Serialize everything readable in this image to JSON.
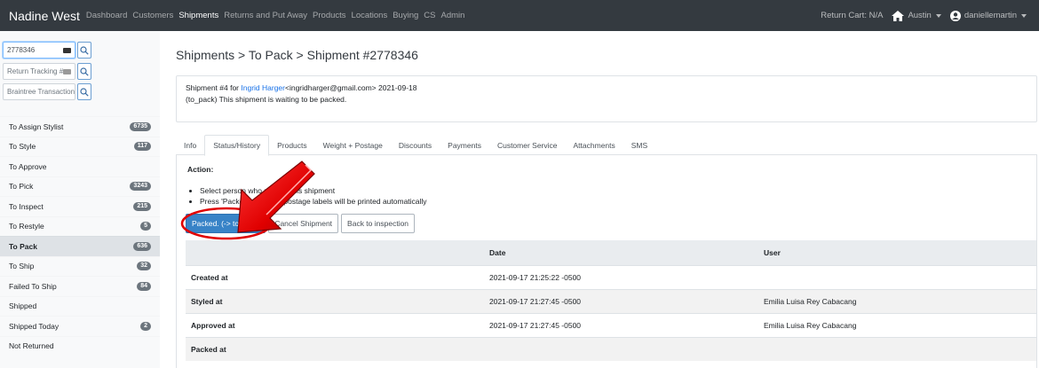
{
  "navbar": {
    "brand": "Nadine West",
    "links": [
      "Dashboard",
      "Customers",
      "Shipments",
      "Returns and Put Away",
      "Products",
      "Locations",
      "Buying",
      "CS",
      "Admin"
    ],
    "active_link": "Shipments",
    "return_cart": "Return Cart: N/A",
    "location": "Austin",
    "user": "daniellemartin"
  },
  "sidebar": {
    "search_value": "2778346",
    "return_tracking_placeholder": "Return Tracking #",
    "braintree_placeholder": "Braintree Transaction",
    "items": [
      {
        "label": "To Assign Stylist",
        "badge": "6735"
      },
      {
        "label": "To Style",
        "badge": "117"
      },
      {
        "label": "To Approve",
        "badge": ""
      },
      {
        "label": "To Pick",
        "badge": "3243"
      },
      {
        "label": "To Inspect",
        "badge": "215"
      },
      {
        "label": "To Restyle",
        "badge": "5"
      },
      {
        "label": "To Pack",
        "badge": "636"
      },
      {
        "label": "To Ship",
        "badge": "32"
      },
      {
        "label": "Failed To Ship",
        "badge": "84"
      },
      {
        "label": "Shipped",
        "badge": ""
      },
      {
        "label": "Shipped Today",
        "badge": "2"
      },
      {
        "label": "Not Returned",
        "badge": ""
      }
    ],
    "active_item": "To Pack"
  },
  "main": {
    "breadcrumb": "Shipments > To Pack > Shipment #2778346",
    "info": {
      "prefix": "Shipment #4 for ",
      "customer_name": "Ingrid Harger",
      "customer_email_and_date": "<ingridharger@gmail.com> 2021-09-18",
      "status_line": "(to_pack) This shipment is waiting to be packed."
    },
    "tabs": [
      "Info",
      "Status/History",
      "Products",
      "Weight + Postage",
      "Discounts",
      "Payments",
      "Customer Service",
      "Attachments",
      "SMS"
    ],
    "active_tab": "Status/History",
    "action_label": "Action:",
    "bullets": [
      "Select person who packed this shipment",
      "Press 'Packed', shipping postage labels will be printed automatically"
    ],
    "buttons": {
      "packed": "Packed. (-> to_ship)",
      "cancel": "Cancel Shipment",
      "back": "Back to inspection"
    },
    "table": {
      "headers": [
        "",
        "Date",
        "User"
      ],
      "rows": [
        {
          "event": "Created at",
          "date": "2021-09-17 21:25:22 -0500",
          "user": ""
        },
        {
          "event": "Styled at",
          "date": "2021-09-17 21:27:45 -0500",
          "user": "Emilia Luisa Rey Cabacang"
        },
        {
          "event": "Approved at",
          "date": "2021-09-17 21:27:45 -0500",
          "user": "Emilia Luisa Rey Cabacang"
        },
        {
          "event": "Packed at",
          "date": "",
          "user": ""
        }
      ]
    }
  },
  "colors": {
    "navbar": "#343a40",
    "primary": "#3883c7",
    "annotation": "#e00000"
  }
}
